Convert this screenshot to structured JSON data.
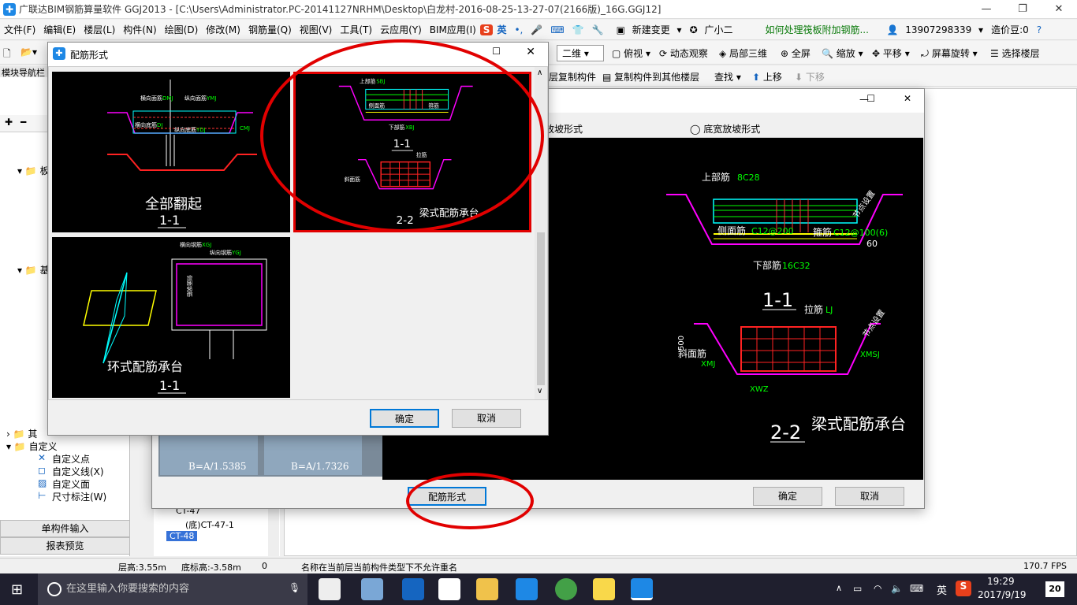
{
  "app": {
    "title": "广联达BIM钢筋算量软件 GGJ2013 - [C:\\Users\\Administrator.PC-20141127NRHM\\Desktop\\白龙村-2016-08-25-13-27-07(2166版)_16G.GGJ12]",
    "window_min": "—",
    "window_max": "❐",
    "window_close": "✕"
  },
  "menu": {
    "items": [
      "文件(F)",
      "编辑(E)",
      "楼层(L)",
      "构件(N)",
      "绘图(D)",
      "修改(M)",
      "钢筋量(Q)",
      "视图(V)",
      "工具(T)",
      "云应用(Y)",
      "BIM应用(I)"
    ],
    "ime_items": [
      "英",
      "•,",
      "🎤",
      "⌨",
      "👕",
      "🔧"
    ],
    "new_change": "新建变更",
    "guangxiaoer": "广小二",
    "question_link": "如何处理筏板附加钢筋...",
    "phone": "13907298339",
    "zaojiadou": "造价豆:0"
  },
  "toolbar1": {
    "view_mode": "二维",
    "items": [
      "俯视",
      "动态观察",
      "局部三维",
      "全屏",
      "缩放",
      "平移",
      "屏幕旋转",
      "选择楼层"
    ]
  },
  "toolbar2": {
    "items": [
      "层复制构件",
      "复制构件到其他楼层",
      "查找",
      "上移",
      "下移"
    ]
  },
  "sidebar": {
    "header": "模块导航栏",
    "tree": [
      "板",
      "基",
      "其",
      "自定义",
      "自定义点",
      "自定义线(X)",
      "自定义面",
      "尺寸标注(W)"
    ],
    "single_input": "单构件输入",
    "report_preview": "报表预览"
  },
  "component_list": {
    "items": [
      "CT-47",
      "(底)CT-47-1",
      "CT-48"
    ],
    "thumb_labels": [
      "B=A/1.5385",
      "B=A/1.7326"
    ]
  },
  "back_dialog": {
    "radio_options": [
      "放坡形式",
      "底宽放坡形式"
    ],
    "config_button": "配筋形式",
    "ok": "确定",
    "cancel": "取消",
    "drawing": {
      "top_rebar": "上部筋",
      "top_rebar_spec": "8C28",
      "side_rebar": "侧面筋",
      "side_rebar_spec": "C12@200",
      "stirrup": "箍筋",
      "stirrup_spec": "C12@100(6)",
      "bottom_rebar": "下部筋",
      "bottom_rebar_spec": "16C32",
      "section_1": "1-1",
      "section_2": "2-2",
      "tie": "拉筋",
      "tie_code": "LJ",
      "slope_face": "斜面筋",
      "xmj": "XMJ",
      "xmsj": "XMSJ",
      "xwz": "XWZ",
      "angle": "60",
      "dim_500": "500",
      "label_1": "1",
      "beam_title": "梁式配筋承台",
      "curtain_text": "节点设置"
    }
  },
  "front_dialog": {
    "title": "配筋形式",
    "ok": "确定",
    "cancel": "取消",
    "options": [
      {
        "caption": "全部翻起",
        "section": "1-1"
      },
      {
        "caption": "梁式配筋承台",
        "section": "2-2",
        "section_top": "1-1"
      },
      {
        "caption": "环式配筋承台",
        "section": "1-1"
      }
    ],
    "labels": {
      "top_face": "横向面筋",
      "dmj": "DMJ",
      "long_face": "纵向面筋",
      "ymj": "YMJ",
      "bottom": "横向底筋",
      "dj": "DJ",
      "long_bottom": "纵向底筋",
      "ydj": "YDJ",
      "side": "侧面钢筋",
      "cmj": "CMJ",
      "xgj": "XGJ",
      "ygj": "YGJ",
      "h_rebar": "横向钢筋",
      "v_rebar": "纵向钢筋",
      "top_label": "上部筋",
      "top_code": "SBJ",
      "side_label": "侧面筋",
      "stir_label": "箍筋",
      "bot_label": "下部筋",
      "bot_code": "XBJ",
      "tie_label": "拉筋",
      "slope_label": "斜面筋",
      "ring_side": "侧面钢筋"
    }
  },
  "statusbar": {
    "floor_height": "层高:3.55m",
    "bottom_elev": "底标高:-3.58m",
    "zero": "0",
    "message": "名称在当前层当前构件类型下不允许重名",
    "fps": "170.7 FPS"
  },
  "taskbar": {
    "search_placeholder": "在这里输入你要搜索的内容",
    "ime": "英",
    "time": "19:29",
    "date": "2017/9/19",
    "notif_count": "20"
  },
  "colors": {
    "annotation_red": "#e10000",
    "accent_blue": "#0078d7",
    "rebar_green": "#00ff00",
    "rebar_magenta": "#ff00ff",
    "rebar_yellow": "#ffff00",
    "rebar_cyan": "#00ffff"
  }
}
